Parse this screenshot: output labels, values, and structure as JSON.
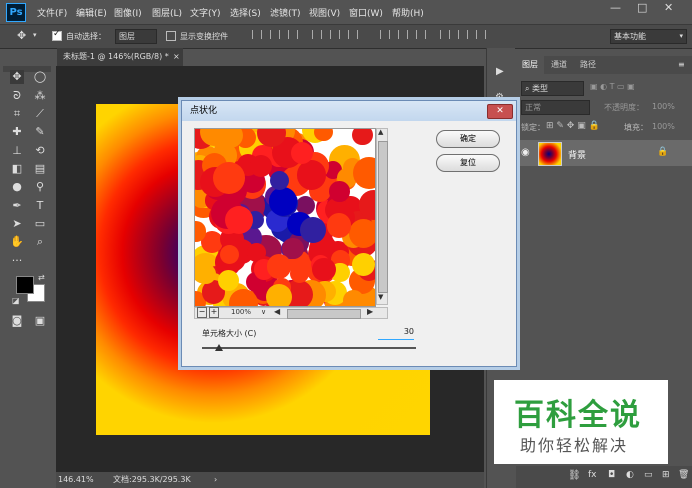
{
  "app": {
    "logo": "Ps"
  },
  "menu": [
    "文件(F)",
    "编辑(E)",
    "图像(I)",
    "图层(L)",
    "文字(Y)",
    "选择(S)",
    "滤镜(T)",
    "视图(V)",
    "窗口(W)",
    "帮助(H)"
  ],
  "window_controls": {
    "minimize": "—",
    "restore": "□",
    "close": "✕"
  },
  "options_bar": {
    "auto_select_label": "自动选择：",
    "auto_select_value": "图层",
    "show_transform_label": "显示变换控件",
    "workspace": "基本功能"
  },
  "document": {
    "tab_title": "未标题-1 @ 146%(RGB/8) *",
    "tab_close": "×"
  },
  "status_bar": {
    "zoom": "146.41%",
    "doc_info": "文档:295.3K/295.3K",
    "arrow": "›"
  },
  "panels": {
    "tabs": [
      "图层",
      "通道",
      "路径"
    ],
    "filter_kind": "类型",
    "blend_mode": "正常",
    "opacity_label": "不透明度：",
    "opacity_value": "100%",
    "lock_label": "锁定：",
    "fill_label": "填充：",
    "fill_value": "100%",
    "layer": {
      "name": "背景"
    }
  },
  "dialog": {
    "title": "点状化",
    "ok": "确定",
    "reset": "复位",
    "zoom": "100%",
    "cell_size_label": "单元格大小 (C)",
    "cell_size_value": "30",
    "cell_size_fraction": 0.08
  },
  "watermark": {
    "title": "百科全说",
    "subtitle": "助你轻松解决"
  },
  "colors": {
    "accent": "#31a8ff",
    "foreground": "#000000",
    "background": "#ffffff",
    "watermark_green": "#2e9e3e"
  }
}
